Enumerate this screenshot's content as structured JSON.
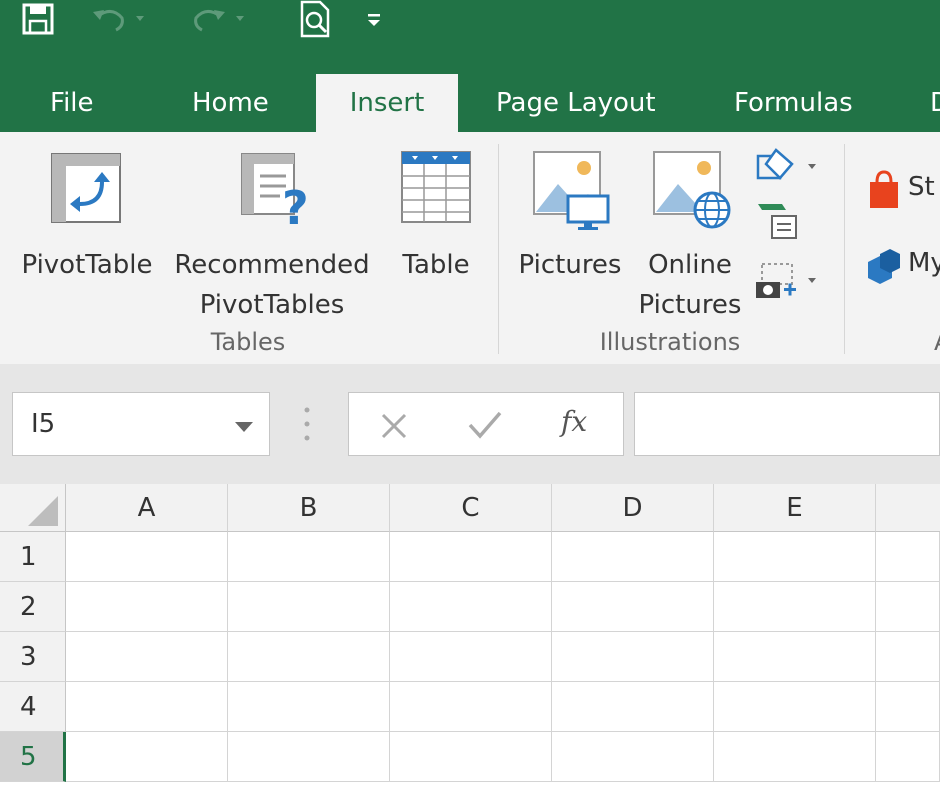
{
  "qat": {
    "save_icon": "save-icon",
    "undo_icon": "undo-icon",
    "redo_icon": "redo-icon",
    "preview_icon": "print-preview-icon",
    "customize_icon": "customize-qat-icon"
  },
  "tabs": [
    {
      "label": "File"
    },
    {
      "label": "Home"
    },
    {
      "label": "Insert",
      "active": true
    },
    {
      "label": "Page Layout"
    },
    {
      "label": "Formulas"
    },
    {
      "label": "D"
    }
  ],
  "ribbon": {
    "tables": {
      "group_label": "Tables",
      "pivottable": "PivotTable",
      "recommended_line1": "Recommended",
      "recommended_line2": "PivotTables",
      "table": "Table"
    },
    "illustrations": {
      "group_label": "Illustrations",
      "pictures": "Pictures",
      "online_line1": "Online",
      "online_line2": "Pictures"
    },
    "addins": {
      "store": "St",
      "my_addins": "My",
      "group_label_partial": "A"
    }
  },
  "formula_bar": {
    "name_box": "I5",
    "fx_label": "fx",
    "formula_value": ""
  },
  "grid": {
    "columns": [
      "A",
      "B",
      "C",
      "D",
      "E"
    ],
    "rows": [
      "1",
      "2",
      "3",
      "4",
      "5"
    ],
    "selected_row": "5",
    "selected_cell": "I5"
  },
  "colors": {
    "accent": "#217346",
    "ribbon_bg": "#f3f3f3"
  }
}
